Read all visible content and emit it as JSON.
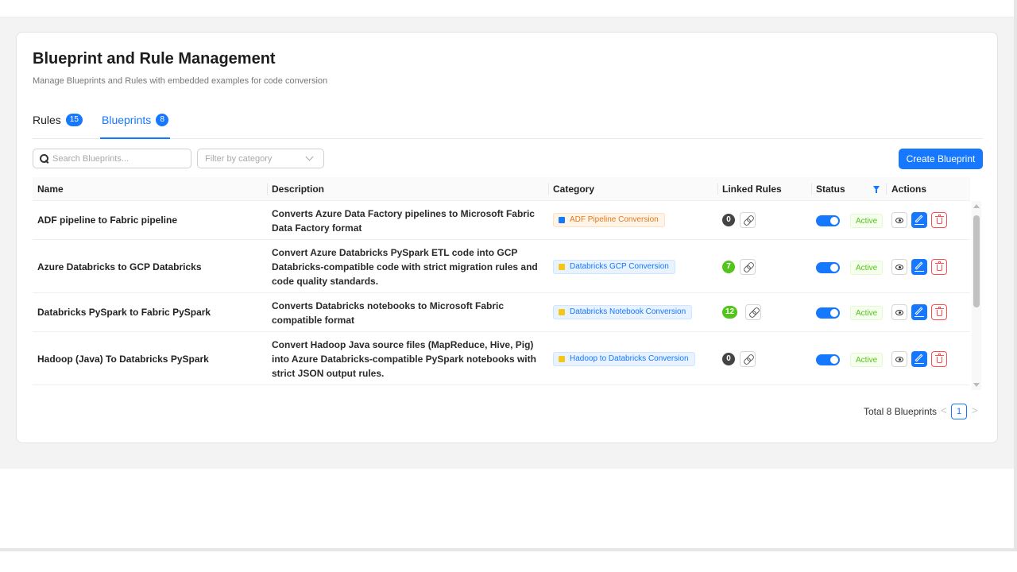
{
  "header": {
    "title": "Blueprint and Rule Management",
    "subtitle": "Manage Blueprints and Rules with embedded examples for code conversion"
  },
  "tabs": [
    {
      "label": "Rules",
      "count": "15",
      "active": false
    },
    {
      "label": "Blueprints",
      "count": "8",
      "active": true
    }
  ],
  "toolbar": {
    "search_placeholder": "Search Blueprints...",
    "filter_placeholder": "Filter by category",
    "create_label": "Create Blueprint"
  },
  "table": {
    "columns": [
      "Name",
      "Description",
      "Category",
      "Linked Rules",
      "Status",
      "Actions"
    ],
    "rows": [
      {
        "name": "ADF pipeline to Fabric pipeline",
        "description": "Converts Azure Data Factory pipelines to Microsoft Fabric Data Factory format",
        "category": "ADF Pipeline Conversion",
        "category_color": "#e07a1f",
        "linked_rules": "0",
        "status": "Active",
        "enabled": true
      },
      {
        "name": "Azure Databricks to GCP Databricks",
        "description": "Convert Azure Databricks PySpark ETL code into GCP Databricks-compatible code with strict migration rules and code quality standards.",
        "category": "Databricks GCP Conversion",
        "category_color": "#1677ff",
        "linked_rules": "7",
        "status": "Active",
        "enabled": true
      },
      {
        "name": "Databricks PySpark to Fabric PySpark",
        "description": "Converts Databricks notebooks to Microsoft Fabric compatible format",
        "category": "Databricks Notebook Conversion",
        "category_color": "#1677ff",
        "linked_rules": "12",
        "status": "Active",
        "enabled": true
      },
      {
        "name": "Hadoop (Java) To Databricks PySpark",
        "description": "Convert Hadoop Java source files (MapReduce, Hive, Pig) into Azure Databricks-compatible PySpark notebooks with strict JSON output rules.",
        "category": "Hadoop to Databricks Conversion",
        "category_color": "#1677ff",
        "linked_rules": "0",
        "status": "Active",
        "enabled": true
      }
    ]
  },
  "pagination": {
    "total_label": "Total 8 Blueprints",
    "current_page": "1",
    "prev_symbol": "<",
    "next_symbol": ">"
  },
  "colors": {
    "primary": "#1677ff",
    "success": "#52c41a",
    "danger": "#ff4d4f"
  }
}
